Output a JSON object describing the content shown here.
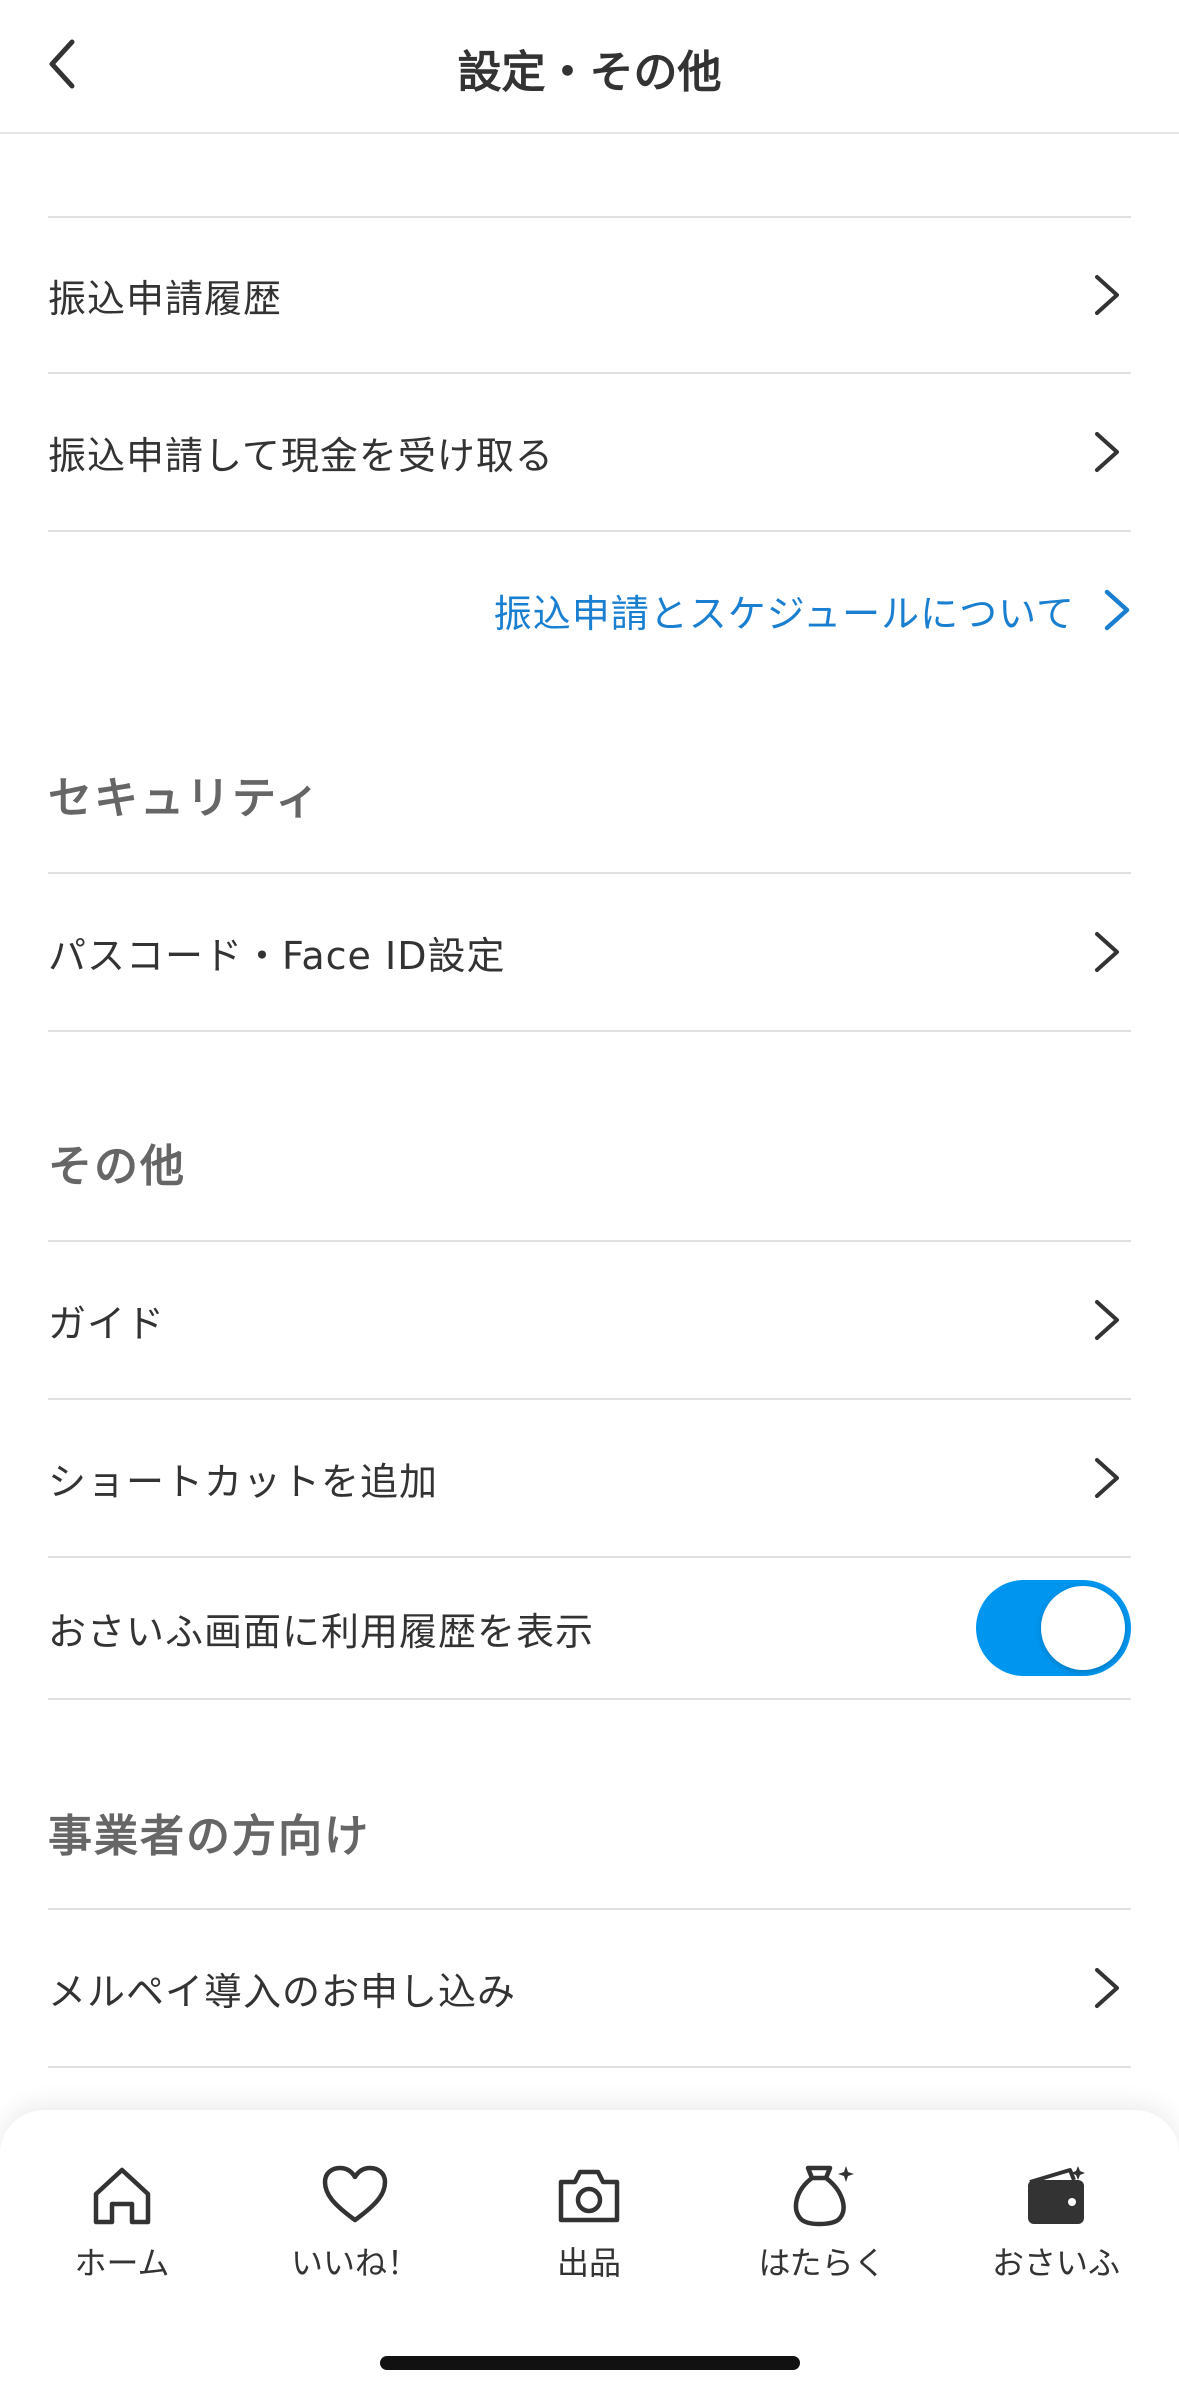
{
  "header": {
    "title": "設定・その他",
    "back_icon": "chevron-left-icon"
  },
  "transfer": {
    "history_label": "振込申請履歴",
    "cash_label": "振込申請して現金を受け取る",
    "about_link": "振込申請とスケジュールについて"
  },
  "security": {
    "title": "セキュリティ",
    "passcode_label": "パスコード・Face ID設定"
  },
  "other": {
    "title": "その他",
    "guide_label": "ガイド",
    "shortcut_label": "ショートカットを追加",
    "history_toggle_label": "おさいふ画面に利用履歴を表示",
    "history_toggle_on": true
  },
  "business": {
    "title": "事業者の方向け",
    "merpay_apply_label": "メルペイ導入のお申し込み"
  },
  "colors": {
    "accent": "#0095ee",
    "link": "#1a7fd1"
  },
  "bottom_nav": {
    "items": [
      {
        "label": "ホーム",
        "icon": "home-icon"
      },
      {
        "label": "いいね！",
        "icon": "heart-icon"
      },
      {
        "label": "出品",
        "icon": "camera-icon"
      },
      {
        "label": "はたらく",
        "icon": "money-bag-icon"
      },
      {
        "label": "おさいふ",
        "icon": "wallet-icon"
      }
    ]
  }
}
